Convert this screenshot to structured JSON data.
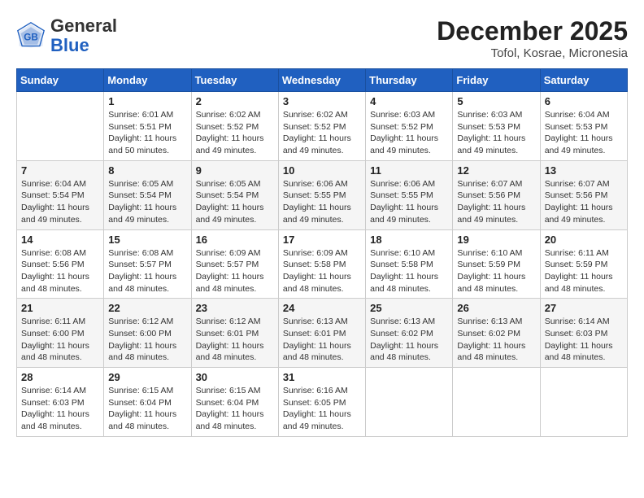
{
  "header": {
    "logo_general": "General",
    "logo_blue": "Blue",
    "month_title": "December 2025",
    "location": "Tofol, Kosrae, Micronesia"
  },
  "weekdays": [
    "Sunday",
    "Monday",
    "Tuesday",
    "Wednesday",
    "Thursday",
    "Friday",
    "Saturday"
  ],
  "weeks": [
    [
      {
        "day": "",
        "info": ""
      },
      {
        "day": "1",
        "info": "Sunrise: 6:01 AM\nSunset: 5:51 PM\nDaylight: 11 hours\nand 50 minutes."
      },
      {
        "day": "2",
        "info": "Sunrise: 6:02 AM\nSunset: 5:52 PM\nDaylight: 11 hours\nand 49 minutes."
      },
      {
        "day": "3",
        "info": "Sunrise: 6:02 AM\nSunset: 5:52 PM\nDaylight: 11 hours\nand 49 minutes."
      },
      {
        "day": "4",
        "info": "Sunrise: 6:03 AM\nSunset: 5:52 PM\nDaylight: 11 hours\nand 49 minutes."
      },
      {
        "day": "5",
        "info": "Sunrise: 6:03 AM\nSunset: 5:53 PM\nDaylight: 11 hours\nand 49 minutes."
      },
      {
        "day": "6",
        "info": "Sunrise: 6:04 AM\nSunset: 5:53 PM\nDaylight: 11 hours\nand 49 minutes."
      }
    ],
    [
      {
        "day": "7",
        "info": "Sunrise: 6:04 AM\nSunset: 5:54 PM\nDaylight: 11 hours\nand 49 minutes."
      },
      {
        "day": "8",
        "info": "Sunrise: 6:05 AM\nSunset: 5:54 PM\nDaylight: 11 hours\nand 49 minutes."
      },
      {
        "day": "9",
        "info": "Sunrise: 6:05 AM\nSunset: 5:54 PM\nDaylight: 11 hours\nand 49 minutes."
      },
      {
        "day": "10",
        "info": "Sunrise: 6:06 AM\nSunset: 5:55 PM\nDaylight: 11 hours\nand 49 minutes."
      },
      {
        "day": "11",
        "info": "Sunrise: 6:06 AM\nSunset: 5:55 PM\nDaylight: 11 hours\nand 49 minutes."
      },
      {
        "day": "12",
        "info": "Sunrise: 6:07 AM\nSunset: 5:56 PM\nDaylight: 11 hours\nand 49 minutes."
      },
      {
        "day": "13",
        "info": "Sunrise: 6:07 AM\nSunset: 5:56 PM\nDaylight: 11 hours\nand 49 minutes."
      }
    ],
    [
      {
        "day": "14",
        "info": "Sunrise: 6:08 AM\nSunset: 5:56 PM\nDaylight: 11 hours\nand 48 minutes."
      },
      {
        "day": "15",
        "info": "Sunrise: 6:08 AM\nSunset: 5:57 PM\nDaylight: 11 hours\nand 48 minutes."
      },
      {
        "day": "16",
        "info": "Sunrise: 6:09 AM\nSunset: 5:57 PM\nDaylight: 11 hours\nand 48 minutes."
      },
      {
        "day": "17",
        "info": "Sunrise: 6:09 AM\nSunset: 5:58 PM\nDaylight: 11 hours\nand 48 minutes."
      },
      {
        "day": "18",
        "info": "Sunrise: 6:10 AM\nSunset: 5:58 PM\nDaylight: 11 hours\nand 48 minutes."
      },
      {
        "day": "19",
        "info": "Sunrise: 6:10 AM\nSunset: 5:59 PM\nDaylight: 11 hours\nand 48 minutes."
      },
      {
        "day": "20",
        "info": "Sunrise: 6:11 AM\nSunset: 5:59 PM\nDaylight: 11 hours\nand 48 minutes."
      }
    ],
    [
      {
        "day": "21",
        "info": "Sunrise: 6:11 AM\nSunset: 6:00 PM\nDaylight: 11 hours\nand 48 minutes."
      },
      {
        "day": "22",
        "info": "Sunrise: 6:12 AM\nSunset: 6:00 PM\nDaylight: 11 hours\nand 48 minutes."
      },
      {
        "day": "23",
        "info": "Sunrise: 6:12 AM\nSunset: 6:01 PM\nDaylight: 11 hours\nand 48 minutes."
      },
      {
        "day": "24",
        "info": "Sunrise: 6:13 AM\nSunset: 6:01 PM\nDaylight: 11 hours\nand 48 minutes."
      },
      {
        "day": "25",
        "info": "Sunrise: 6:13 AM\nSunset: 6:02 PM\nDaylight: 11 hours\nand 48 minutes."
      },
      {
        "day": "26",
        "info": "Sunrise: 6:13 AM\nSunset: 6:02 PM\nDaylight: 11 hours\nand 48 minutes."
      },
      {
        "day": "27",
        "info": "Sunrise: 6:14 AM\nSunset: 6:03 PM\nDaylight: 11 hours\nand 48 minutes."
      }
    ],
    [
      {
        "day": "28",
        "info": "Sunrise: 6:14 AM\nSunset: 6:03 PM\nDaylight: 11 hours\nand 48 minutes."
      },
      {
        "day": "29",
        "info": "Sunrise: 6:15 AM\nSunset: 6:04 PM\nDaylight: 11 hours\nand 48 minutes."
      },
      {
        "day": "30",
        "info": "Sunrise: 6:15 AM\nSunset: 6:04 PM\nDaylight: 11 hours\nand 48 minutes."
      },
      {
        "day": "31",
        "info": "Sunrise: 6:16 AM\nSunset: 6:05 PM\nDaylight: 11 hours\nand 49 minutes."
      },
      {
        "day": "",
        "info": ""
      },
      {
        "day": "",
        "info": ""
      },
      {
        "day": "",
        "info": ""
      }
    ]
  ]
}
